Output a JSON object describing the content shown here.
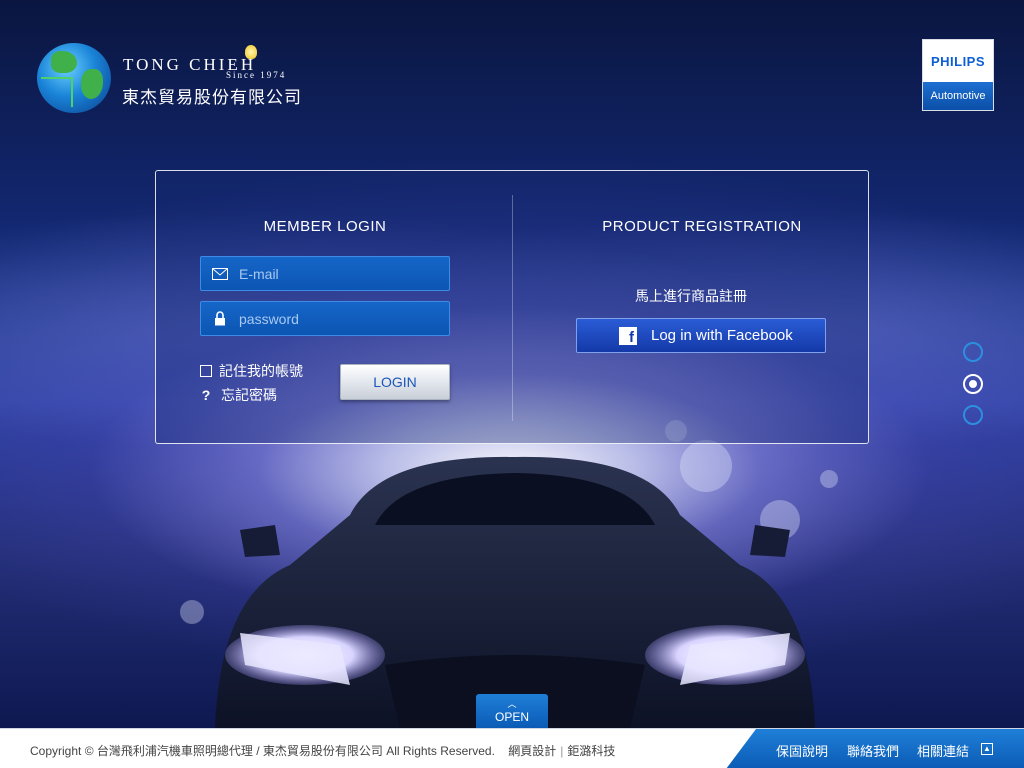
{
  "header": {
    "brand_en": "TONG CHIEH",
    "brand_since": "Since 1974",
    "brand_zh": "東杰貿易股份有限公司",
    "partner": {
      "word": "PHILIPS",
      "sub": "Automotive"
    }
  },
  "login": {
    "title": "MEMBER LOGIN",
    "email_placeholder": "E-mail",
    "password_placeholder": "password",
    "remember_label": "記住我的帳號",
    "forgot_label": "忘記密碼",
    "login_button": "LOGIN"
  },
  "registration": {
    "title": "PRODUCT REGISTRATION",
    "text": "馬上進行商品註冊",
    "facebook_button": "Log in with Facebook"
  },
  "slider": {
    "active_index": 1,
    "count": 3
  },
  "open_tab": {
    "label": "OPEN"
  },
  "footer": {
    "copyright": "Copyright © 台灣飛利浦汽機車照明總代理 / 東杰貿易股份有限公司 All Rights Reserved.",
    "design": "網頁設計",
    "designer": "鉅潞科技",
    "links": [
      "保固說明",
      "聯絡我們",
      "相關連結"
    ]
  },
  "colors": {
    "accent_blue": "#0b5bb5",
    "field_blue": "#1566c8",
    "facebook_blue": "#1439a8"
  }
}
